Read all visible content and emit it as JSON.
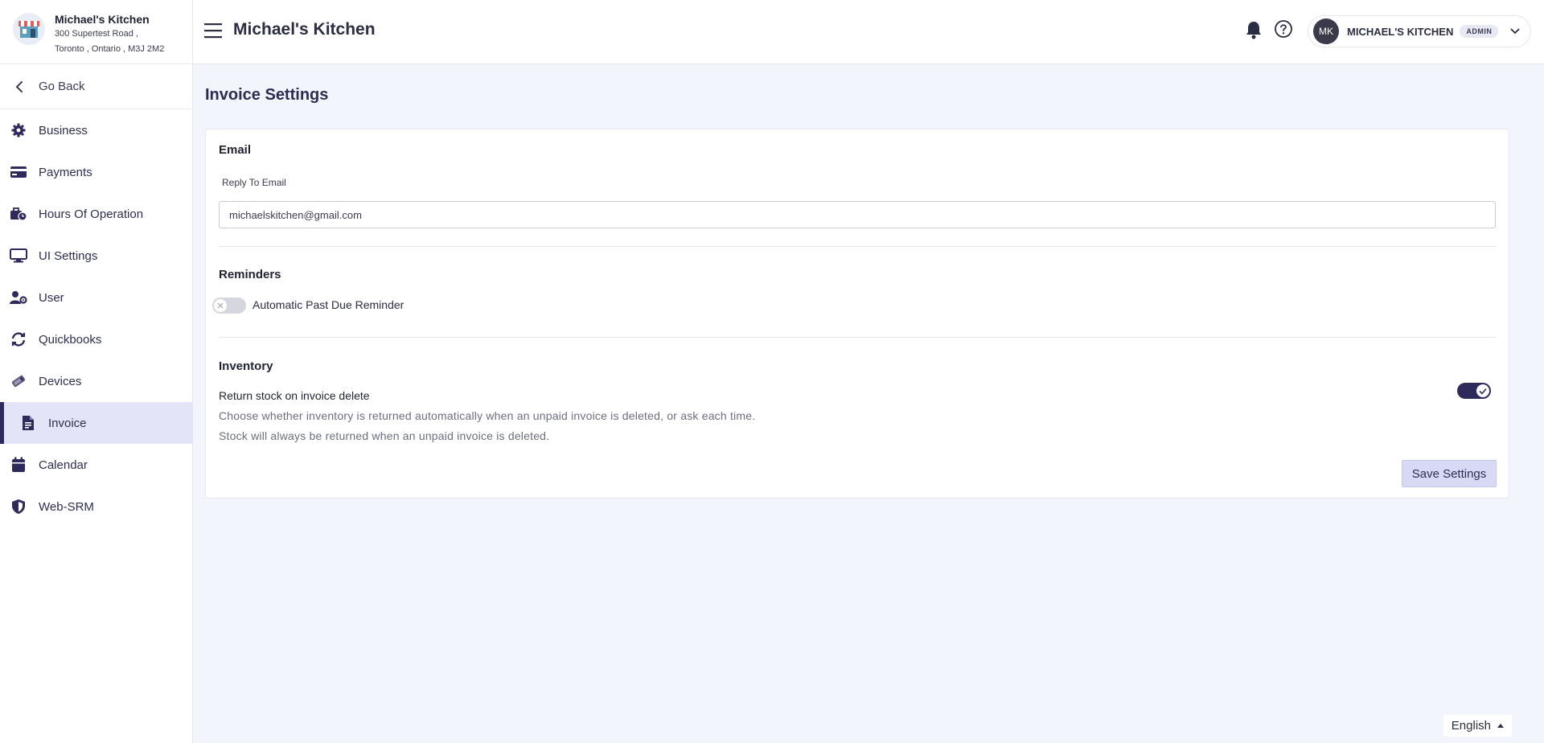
{
  "business": {
    "name": "Michael's Kitchen",
    "address_line1": "300 Supertest Road ,",
    "address_line2": "Toronto , Ontario , M3J 2M2"
  },
  "sidebar": {
    "back_label": "Go Back",
    "items": [
      {
        "label": "Business",
        "icon": "gear-icon"
      },
      {
        "label": "Payments",
        "icon": "credit-card-icon"
      },
      {
        "label": "Hours Of Operation",
        "icon": "business-time-icon"
      },
      {
        "label": "UI Settings",
        "icon": "monitor-icon"
      },
      {
        "label": "User",
        "icon": "user-cog-icon"
      },
      {
        "label": "Quickbooks",
        "icon": "sync-icon"
      },
      {
        "label": "Devices",
        "icon": "device-icon"
      },
      {
        "label": "Invoice",
        "icon": "invoice-icon"
      },
      {
        "label": "Calendar",
        "icon": "calendar-icon"
      },
      {
        "label": "Web-SRM",
        "icon": "shield-icon"
      }
    ],
    "active": "Invoice"
  },
  "header": {
    "title": "Michael's Kitchen",
    "user_initials": "MK",
    "user_name": "MICHAEL'S KITCHEN",
    "role": "ADMIN"
  },
  "page": {
    "title": "Invoice Settings",
    "email_section": {
      "title": "Email",
      "label": "Reply To Email",
      "value": "michaelskitchen@gmail.com"
    },
    "reminders_section": {
      "title": "Reminders",
      "toggle_label": "Automatic Past Due Reminder",
      "toggle_on": false
    },
    "inventory_section": {
      "title": "Inventory",
      "label": "Return stock on invoice delete",
      "desc1": "Choose whether inventory is returned automatically when an unpaid invoice is deleted, or ask each time.",
      "desc2": "Stock will always be returned when an unpaid invoice is deleted.",
      "toggle_on": true
    },
    "save_label": "Save Settings"
  },
  "footer": {
    "language": "English"
  },
  "colors": {
    "accent": "#2e2b5c",
    "active_bg": "#e3e4f8",
    "page_bg": "#f2f5fc"
  }
}
